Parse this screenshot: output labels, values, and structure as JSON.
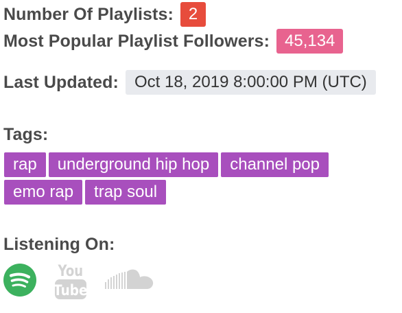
{
  "stats": {
    "playlists_label": "Number Of Playlists:",
    "playlists_value": "2",
    "followers_label": "Most Popular Playlist Followers:",
    "followers_value": "45,134",
    "updated_label": "Last Updated:",
    "updated_value": "Oct 18, 2019 8:00:00 PM (UTC)"
  },
  "tags": {
    "label": "Tags:",
    "items": [
      "rap",
      "underground hip hop",
      "channel pop",
      "emo rap",
      "trap soul"
    ]
  },
  "listening": {
    "label": "Listening On:",
    "services": [
      {
        "name": "spotify-icon",
        "color": "#3cb15e"
      },
      {
        "name": "youtube-icon",
        "color": "#d3d3d3",
        "text_top": "You",
        "text_bottom": "Tube"
      },
      {
        "name": "soundcloud-icon",
        "color": "#d3d3d3"
      }
    ]
  },
  "colors": {
    "count_badge": "#e74c3c",
    "followers_badge": "#e8638f",
    "date_badge": "#e8eaee",
    "tag": "#a84fbd"
  }
}
